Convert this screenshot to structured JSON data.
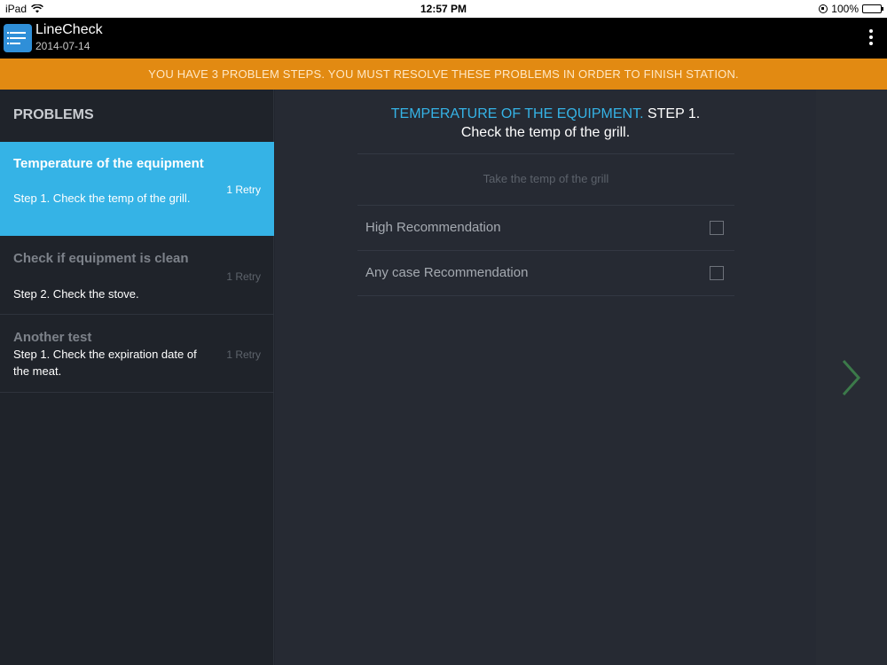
{
  "status_bar": {
    "device": "iPad",
    "time": "12:57 PM",
    "battery": "100%",
    "battery_level": 1.0
  },
  "app": {
    "title": "LineCheck",
    "date": "2014-07-14"
  },
  "banner": {
    "text": "YOU HAVE 3 PROBLEM STEPS. YOU MUST RESOLVE THESE PROBLEMS IN ORDER TO FINISH STATION."
  },
  "sidebar": {
    "heading": "PROBLEMS",
    "items": [
      {
        "title": "Temperature of the equipment",
        "subtitle": "Step 1. Check the temp of the grill.",
        "retry": "1 Retry",
        "active": true
      },
      {
        "title": "Check if equipment is clean",
        "subtitle": "Step 2. Check the stove.",
        "retry": "1 Retry",
        "active": false
      },
      {
        "title": "Another test",
        "subtitle": "Step 1. Check the expiration date of the meat.",
        "retry": "1 Retry",
        "active": false
      }
    ]
  },
  "main": {
    "category": "TEMPERATURE OF THE EQUIPMENT.",
    "step": " STEP 1.",
    "description": "Check the temp of the grill.",
    "hint": "Take the temp of the grill",
    "options": [
      {
        "label": "High Recommendation",
        "checked": false
      },
      {
        "label": "Any case Recommendation",
        "checked": false
      }
    ]
  },
  "colors": {
    "accent": "#35b3e6",
    "banner": "#e28a12",
    "next_arrow": "#3c7a4a"
  }
}
